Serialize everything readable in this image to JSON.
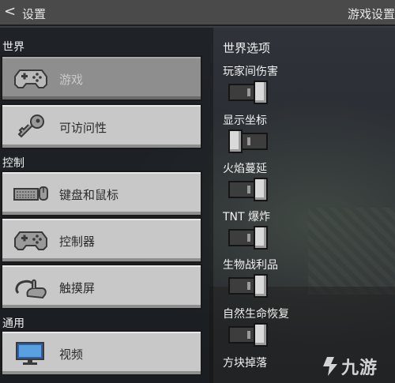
{
  "header": {
    "back_symbol": "<",
    "title": "设置",
    "right_title": "游戏设置"
  },
  "sidebar": {
    "sections": [
      {
        "label": "世界"
      },
      {
        "label": "控制"
      },
      {
        "label": "通用"
      }
    ],
    "items": [
      {
        "label": "游戏",
        "icon": "gamepad-icon",
        "selected": true
      },
      {
        "label": "可访问性",
        "icon": "key-icon",
        "selected": false
      },
      {
        "label": "键盘和鼠标",
        "icon": "keyboard-mouse-icon",
        "selected": false
      },
      {
        "label": "控制器",
        "icon": "gamepad-icon",
        "selected": false
      },
      {
        "label": "触摸屏",
        "icon": "touch-icon",
        "selected": false
      },
      {
        "label": "视频",
        "icon": "monitor-icon",
        "selected": false
      }
    ]
  },
  "options": {
    "header": "世界选项",
    "items": [
      {
        "label": "玩家间伤害",
        "on": true
      },
      {
        "label": "显示坐标",
        "on": false
      },
      {
        "label": "火焰蔓延",
        "on": true
      },
      {
        "label": "TNT 爆炸",
        "on": true
      },
      {
        "label": "生物战利品",
        "on": true
      },
      {
        "label": "自然生命恢复",
        "on": true
      },
      {
        "label": "方块掉落",
        "on": true
      }
    ]
  },
  "watermark": {
    "text": "九游"
  },
  "colors": {
    "button": "#c8c8c8",
    "button_selected": "#8e8e8e",
    "topbar": "#4a4a4a"
  }
}
